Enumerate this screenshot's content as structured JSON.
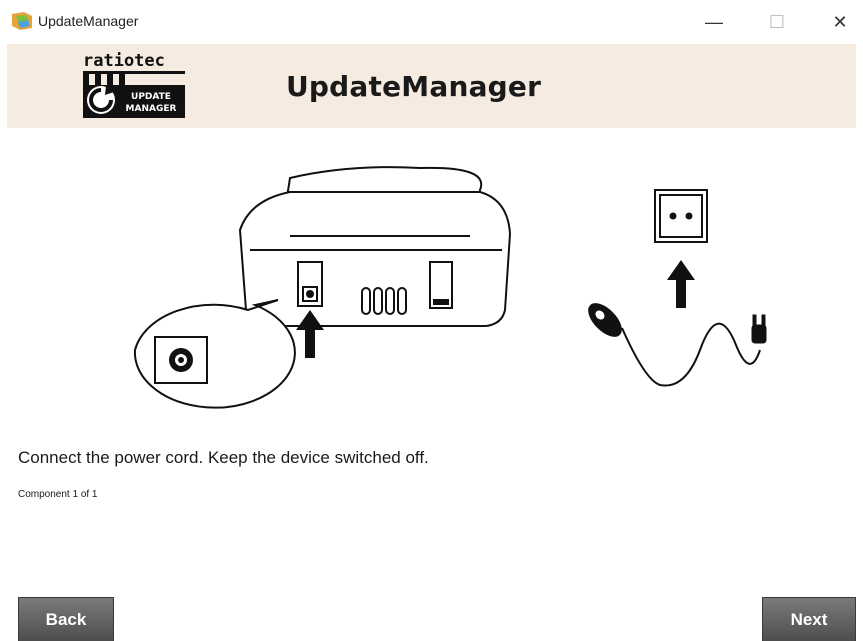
{
  "window": {
    "title": "UpdateManager",
    "icon": "updatemanager-app-icon",
    "controls": {
      "minimize": "—",
      "maximize": "☐",
      "close": "✕"
    }
  },
  "banner": {
    "logo_brand": "ratiotec",
    "logo_badge_line1": "UPDATE",
    "logo_badge_line2": "MANAGER",
    "title": "UpdateManager",
    "background": "#f5ebe0"
  },
  "illustration": {
    "description_icon": "connect-power-cord-illustration"
  },
  "main": {
    "instruction": "Connect the power cord. Keep the device switched off.",
    "component_status": "Component 1 of 1"
  },
  "footer": {
    "back_label": "Back",
    "next_label": "Next",
    "button_color": "#5a5a5a"
  }
}
